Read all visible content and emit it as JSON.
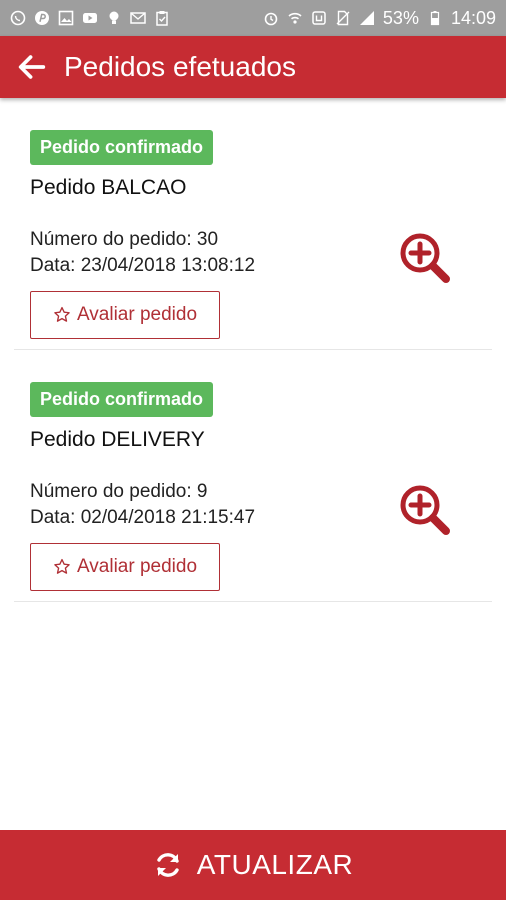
{
  "status_bar": {
    "battery": "53%",
    "time": "14:09",
    "left_icons": [
      "whatsapp-icon",
      "pinterest-icon",
      "gallery-icon",
      "youtube-icon",
      "bulb-icon",
      "mail-icon",
      "clipboard-icon"
    ],
    "right_icons": [
      "alarm-icon",
      "wifi-icon",
      "nfc-icon",
      "no-sim-icon",
      "signal-icon",
      "battery-icon"
    ]
  },
  "header": {
    "title": "Pedidos efetuados",
    "color": "#c62c33"
  },
  "orders": [
    {
      "status": "Pedido confirmado",
      "type": "Pedido BALCAO",
      "number_line": "Número do pedido: 30",
      "date_line": "Data: 23/04/2018 13:08:12",
      "rate_label": "Avaliar pedido"
    },
    {
      "status": "Pedido confirmado",
      "type": "Pedido DELIVERY",
      "number_line": "Número do pedido: 9",
      "date_line": "Data: 02/04/2018 21:15:47",
      "rate_label": "Avaliar pedido"
    }
  ],
  "footer": {
    "refresh_label": "ATUALIZAR"
  },
  "colors": {
    "primary": "#c62c33",
    "badge": "#5cb85c",
    "status_bar": "#9e9e9e"
  }
}
